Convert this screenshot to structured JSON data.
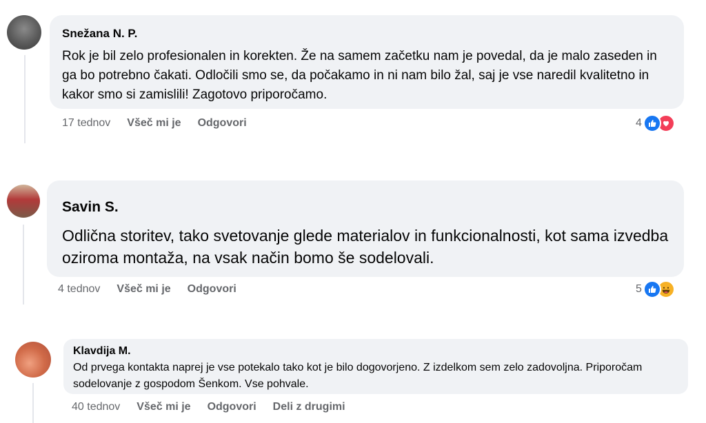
{
  "comments": [
    {
      "author": "Snežana N. P.",
      "text": "Rok je bil zelo profesionalen in korekten. Že na samem začetku nam je povedal, da je malo zaseden in ga bo potrebno čakati. Odločili smo se, da počakamo in ni nam bilo žal, saj je vse naredil kvalitetno in kakor smo si zamislili! Zagotovo priporočamo.",
      "time": "17 tednov",
      "like_label": "Všeč mi je",
      "reply_label": "Odgovori",
      "reaction_count": "4",
      "reactions": [
        "like-icon",
        "love-icon"
      ],
      "colors": {
        "like": "#1877f2",
        "love": "#f33e58"
      }
    },
    {
      "author": "Savin S.",
      "text": "Odlična storitev, tako svetovanje glede materialov in funkcionalnosti, kot sama izvedba oziroma montaža, na vsak način bomo še sodelovali.",
      "time": "4 tednov",
      "like_label": "Všeč mi je",
      "reply_label": "Odgovori",
      "reaction_count": "5",
      "reactions": [
        "like-icon",
        "haha-icon"
      ],
      "colors": {
        "like": "#1877f2",
        "haha": "#f7b125"
      }
    },
    {
      "author": "Klavdija M.",
      "text": "Od prvega kontakta naprej je vse potekalo tako kot je bilo dogovorjeno. Z izdelkom sem zelo zadovoljna. Priporočam sodelovanje z gospodom Šenkom. Vse pohvale.",
      "time": "40 tednov",
      "like_label": "Všeč mi je",
      "reply_label": "Odgovori",
      "share_label": "Deli z drugimi"
    }
  ],
  "colors": {
    "bubble": "#f0f2f5",
    "meta": "#65676b",
    "text": "#050505"
  }
}
